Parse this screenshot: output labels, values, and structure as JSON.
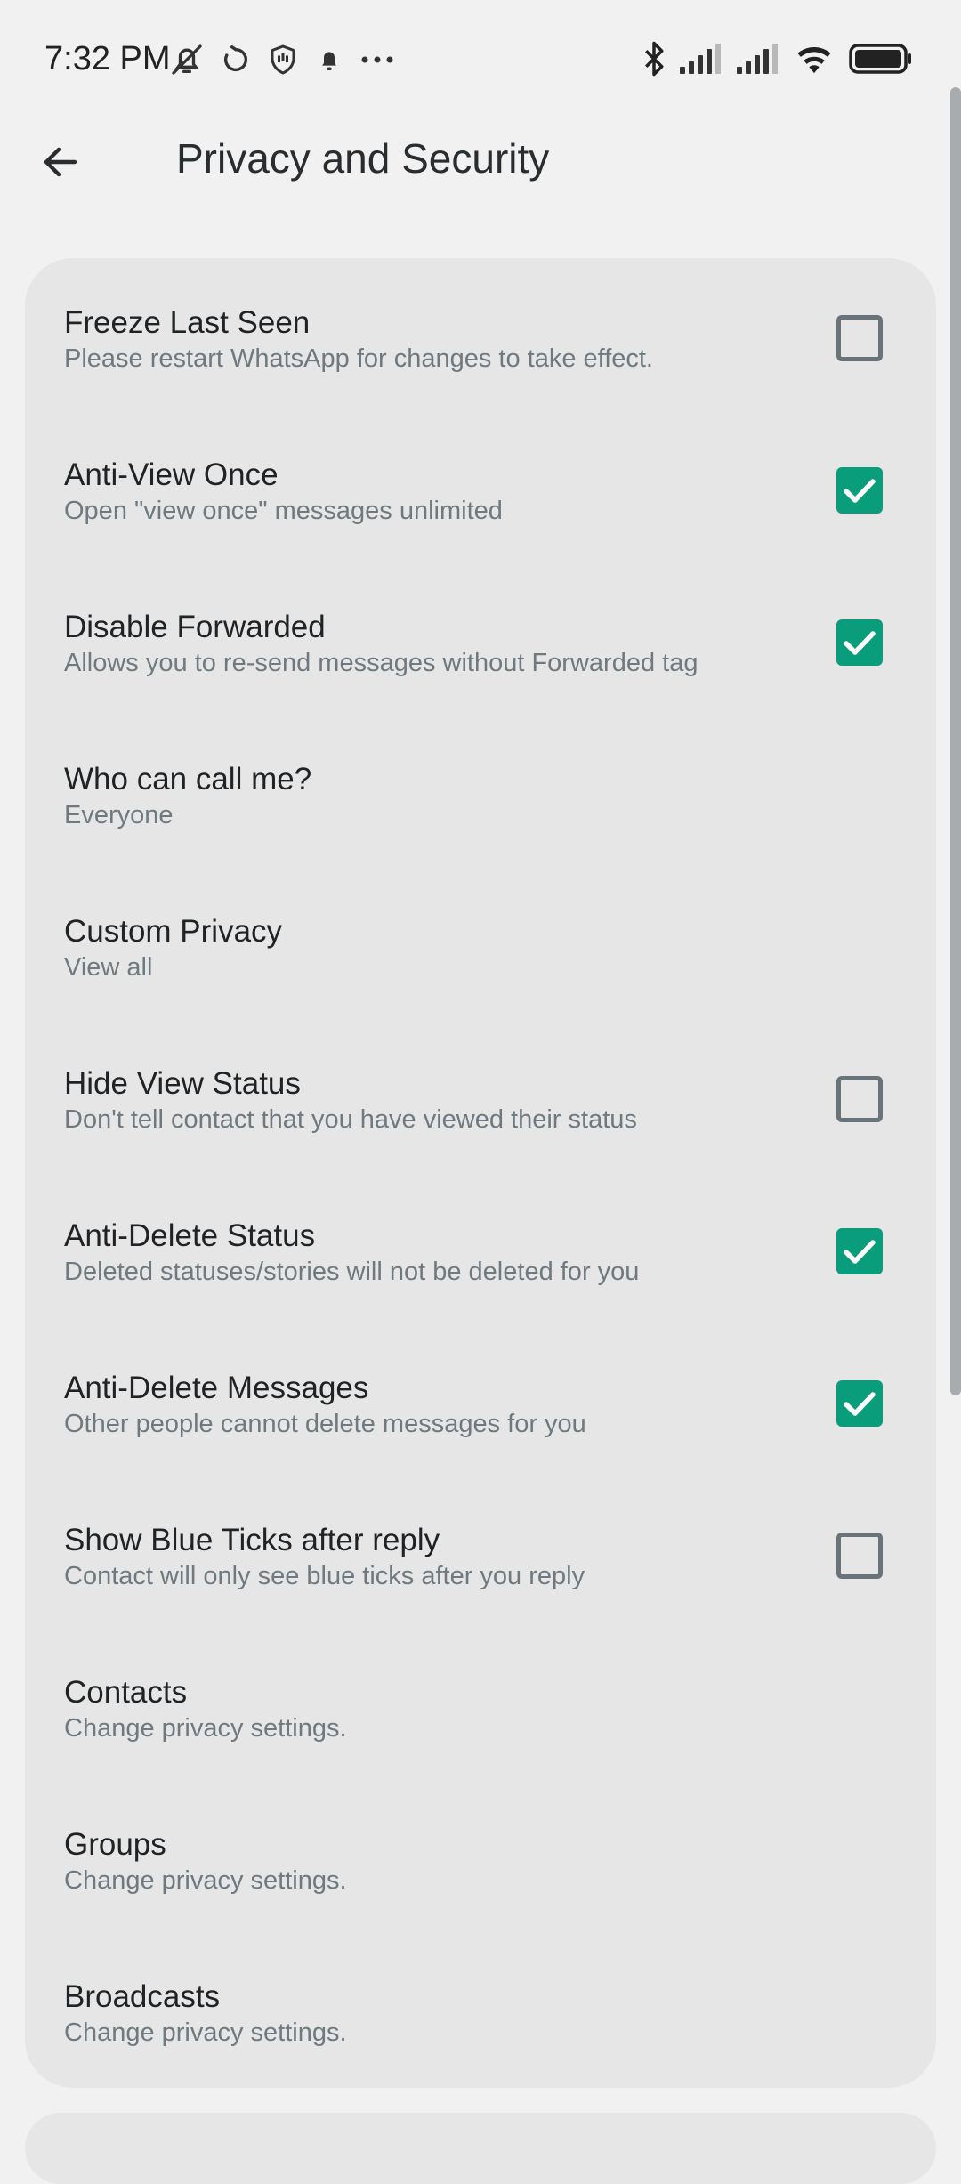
{
  "status_bar": {
    "time": "7:32 PM",
    "left_icons": [
      "mute-bell-icon",
      "sync-icon",
      "hand-shield-icon",
      "notification-bell-icon",
      "more-dots-icon"
    ],
    "right_icons": [
      "bluetooth-icon",
      "signal-1-icon",
      "signal-2-icon",
      "wifi-icon",
      "battery-icon"
    ]
  },
  "app_bar": {
    "back_icon": "arrow-back-icon",
    "title": "Privacy and Security"
  },
  "colors": {
    "background": "#f1f1f1",
    "card": "#e6e6e6",
    "accent": "#0a9d7b",
    "checkbox_border": "#69737a",
    "subtitle": "#6f7a80"
  },
  "settings": [
    {
      "title": "Freeze Last Seen",
      "subtitle": "Please restart WhatsApp for changes to take effect.",
      "has_checkbox": true,
      "checked": false
    },
    {
      "title": "Anti-View Once",
      "subtitle": "Open \"view once\" messages unlimited",
      "has_checkbox": true,
      "checked": true
    },
    {
      "title": "Disable Forwarded",
      "subtitle": "Allows you to re-send messages without Forwarded tag",
      "has_checkbox": true,
      "checked": true
    },
    {
      "title": "Who can call me?",
      "subtitle": "Everyone",
      "has_checkbox": false,
      "checked": false
    },
    {
      "title": "Custom Privacy",
      "subtitle": "View all",
      "has_checkbox": false,
      "checked": false
    },
    {
      "title": "Hide View Status",
      "subtitle": "Don't tell contact that you have viewed their status",
      "has_checkbox": true,
      "checked": false
    },
    {
      "title": "Anti-Delete Status",
      "subtitle": "Deleted statuses/stories will not be deleted for you",
      "has_checkbox": true,
      "checked": true
    },
    {
      "title": "Anti-Delete Messages",
      "subtitle": "Other people cannot delete messages for you",
      "has_checkbox": true,
      "checked": true
    },
    {
      "title": "Show Blue Ticks after reply",
      "subtitle": "Contact will only see blue ticks after you reply",
      "has_checkbox": true,
      "checked": false
    },
    {
      "title": "Contacts",
      "subtitle": "Change privacy settings.",
      "has_checkbox": false,
      "checked": false
    },
    {
      "title": "Groups",
      "subtitle": "Change privacy settings.",
      "has_checkbox": false,
      "checked": false
    },
    {
      "title": "Broadcasts",
      "subtitle": "Change privacy settings.",
      "has_checkbox": false,
      "checked": false
    }
  ]
}
